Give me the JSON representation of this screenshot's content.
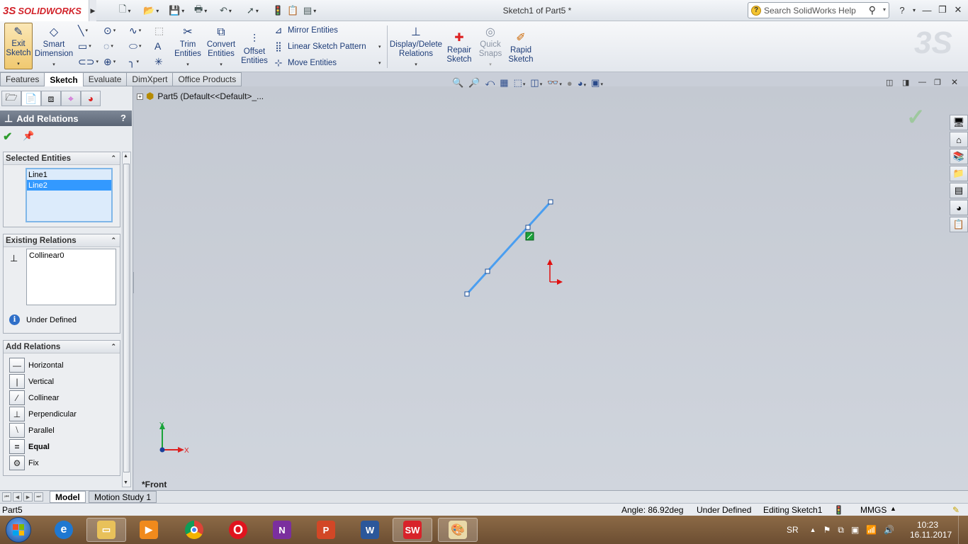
{
  "app": {
    "logo_symbol": "3S",
    "logo_brand": "SOLIDWORKS",
    "document_title": "Sketch1 of Part5 *",
    "search_placeholder": "Search SolidWorks Help",
    "help_glyph": "?"
  },
  "command_manager": {
    "exit_sketch": "Exit Sketch",
    "smart_dimension": "Smart Dimension",
    "trim_entities": "Trim Entities",
    "convert_entities": "Convert Entities",
    "offset_entities": "Offset Entities",
    "mirror_entities": "Mirror Entities",
    "linear_sketch_pattern": "Linear Sketch Pattern",
    "move_entities": "Move Entities",
    "display_delete_relations": "Display/Delete Relations",
    "repair_sketch": "Repair Sketch",
    "quick_snaps": "Quick Snaps",
    "rapid_sketch": "Rapid Sketch"
  },
  "tabs": [
    "Features",
    "Sketch",
    "Evaluate",
    "DimXpert",
    "Office Products"
  ],
  "active_tab": "Sketch",
  "property_manager": {
    "title": "Add Relations",
    "help": "?",
    "selected_entities": {
      "title": "Selected Entities",
      "items": [
        "Line1",
        "Line2"
      ],
      "highlighted": "Line2"
    },
    "existing_relations": {
      "title": "Existing Relations",
      "items": [
        "Collinear0"
      ],
      "status": "Under Defined"
    },
    "add_relations": {
      "title": "Add Relations",
      "items": [
        {
          "label": "Horizontal",
          "glyph": "—",
          "bold": false
        },
        {
          "label": "Vertical",
          "glyph": "|",
          "bold": false
        },
        {
          "label": "Collinear",
          "glyph": "⁄",
          "bold": false
        },
        {
          "label": "Perpendicular",
          "glyph": "⊥",
          "bold": false
        },
        {
          "label": "Parallel",
          "glyph": "⧵",
          "bold": false
        },
        {
          "label": "Equal",
          "glyph": "=",
          "bold": true
        },
        {
          "label": "Fix",
          "glyph": "⚙",
          "bold": false
        }
      ]
    }
  },
  "feature_tree": {
    "root": "Part5  (Default<<Default>_..."
  },
  "viewport": {
    "view_name": "*Front",
    "triad_y": "Y",
    "triad_x": "X"
  },
  "bottom_tabs": [
    "Model",
    "Motion Study 1"
  ],
  "status_bar": {
    "document": "Part5",
    "angle": "Angle: 86.92deg",
    "definition": "Under Defined",
    "editing": "Editing Sketch1",
    "units": "MMGS"
  },
  "taskbar": {
    "language": "SR",
    "time": "10:23",
    "date": "16.11.2017"
  },
  "colors": {
    "sketch_line": "#4a9ef0",
    "relation_marker": "#1aa33a",
    "origin_arrow": "#e01010",
    "accent_blue": "#3399ff"
  }
}
